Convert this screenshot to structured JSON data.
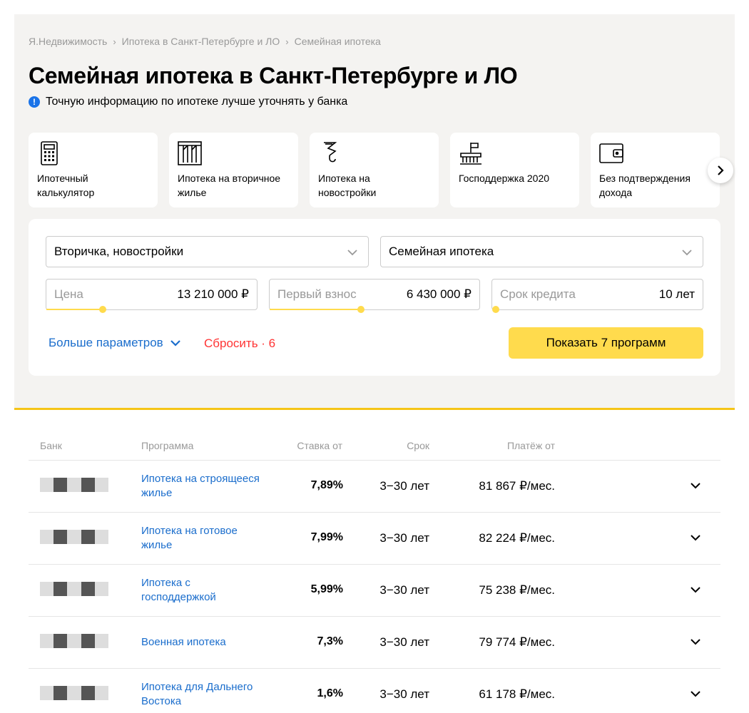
{
  "breadcrumb": [
    "Я.Недвижимость",
    "Ипотека в Санкт-Петербурге и ЛО",
    "Семейная ипотека"
  ],
  "breadcrumb_sep": "›",
  "title": "Семейная ипотека в Санкт-Петербурге и ЛО",
  "notice": "Точную информацию по ипотеке лучше уточнять у банка",
  "cards": [
    {
      "label": "Ипотечный калькулятор",
      "icon": "calculator-icon"
    },
    {
      "label": "Ипотека на вторичное жилье",
      "icon": "building-icon"
    },
    {
      "label": "Ипотека на новостройки",
      "icon": "crane-hook-icon"
    },
    {
      "label": "Господдержка 2020",
      "icon": "government-flag-icon"
    },
    {
      "label": "Без подтверждения дохода",
      "icon": "wallet-icon"
    }
  ],
  "filters": {
    "property_type": "Вторичка, новостройки",
    "program": "Семейная ипотека",
    "price": {
      "placeholder": "Цена",
      "value": "13 210 000 ₽"
    },
    "down_payment": {
      "placeholder": "Первый взнос",
      "value": "6 430 000 ₽"
    },
    "term": {
      "placeholder": "Срок кредита",
      "value": "10 лет"
    },
    "more": "Больше параметров",
    "reset": "Сбросить · 6",
    "show": "Показать 7 программ"
  },
  "table": {
    "headers": {
      "bank": "Банк",
      "program": "Программа",
      "rate": "Ставка от",
      "term": "Срок",
      "payment": "Платёж от"
    },
    "rows": [
      {
        "program": "Ипотека на строящееся жилье",
        "rate": "7,89%",
        "term": "3−30 лет",
        "payment": "81 867 ₽/мес."
      },
      {
        "program": "Ипотека на готовое жилье",
        "rate": "7,99%",
        "term": "3−30 лет",
        "payment": "82 224 ₽/мес."
      },
      {
        "program": "Ипотека с господдержкой",
        "rate": "5,99%",
        "term": "3−30 лет",
        "payment": "75 238 ₽/мес."
      },
      {
        "program": "Военная ипотека",
        "rate": "7,3%",
        "term": "3−30 лет",
        "payment": "79 774 ₽/мес."
      },
      {
        "program": "Ипотека для Дальнего Востока",
        "rate": "1,6%",
        "term": "3−30 лет",
        "payment": "61 178 ₽/мес."
      }
    ]
  },
  "colors": {
    "accent_yellow": "#ffdb4d",
    "link_blue": "#1a6dcc",
    "reset_red": "#ff3333",
    "hero_bg": "#f4f3f1"
  }
}
